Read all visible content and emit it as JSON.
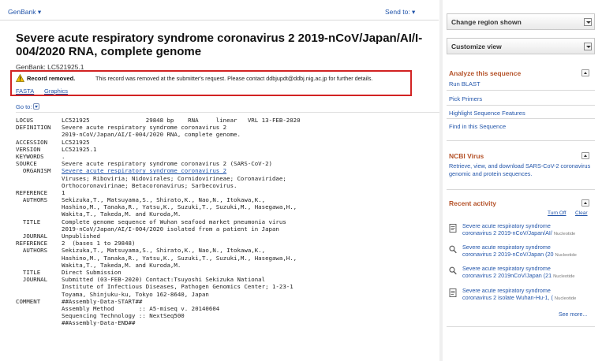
{
  "topbar": {
    "database": "GenBank",
    "send_to": "Send to:"
  },
  "record": {
    "title": "Severe acute respiratory syndrome coronavirus 2 2019-nCoV/Japan/AI/I-004/2020 RNA, complete genome",
    "accession_line": "GenBank: LC521925.1"
  },
  "alert": {
    "title": "Record removed.",
    "message": "This record was removed at the submitter's request. Please contact ddbjupdt@ddbj.nig.ac.jp for further details.",
    "links": [
      "FASTA",
      "Graphics"
    ]
  },
  "goto_label": "Go to:",
  "genbank_lines": [
    {
      "key": "LOCUS",
      "value": "LC521925                29848 bp    RNA     linear   VRL 13-FEB-2020"
    },
    {
      "key": "DEFINITION",
      "value": "Severe acute respiratory syndrome coronavirus 2"
    },
    {
      "key": "",
      "value": "2019-nCoV/Japan/AI/I-004/2020 RNA, complete genome."
    },
    {
      "key": "ACCESSION",
      "value": "LC521925"
    },
    {
      "key": "VERSION",
      "value": "LC521925.1"
    },
    {
      "key": "KEYWORDS",
      "value": "."
    },
    {
      "key": "SOURCE",
      "value": "Severe acute respiratory syndrome coronavirus 2 (SARS-CoV-2)"
    },
    {
      "key": "  ORGANISM",
      "value": "Severe acute respiratory syndrome coronavirus 2",
      "link": true
    },
    {
      "key": "",
      "value": "Viruses; Riboviria; Nidovirales; Cornidovirineae; Coronaviridae;"
    },
    {
      "key": "",
      "value": "Orthocoronavirinae; Betacoronavirus; Sarbecovirus."
    },
    {
      "key": "REFERENCE",
      "value": "1"
    },
    {
      "key": "  AUTHORS",
      "value": "Sekizuka,T., Matsuyama,S., Shirato,K., Nao,N., Itokawa,K.,"
    },
    {
      "key": "",
      "value": "Hashino,M., Tanaka,R., Yatsu,K., Suzuki,T., Suzuki,M., Hasegawa,H.,"
    },
    {
      "key": "",
      "value": "Wakita,T., Takeda,M. and Kuroda,M."
    },
    {
      "key": "  TITLE",
      "value": "Complete genome sequence of Wuhan seafood market pneumonia virus"
    },
    {
      "key": "",
      "value": "2019-nCoV/Japan/AI/I-004/2020 isolated from a patient in Japan"
    },
    {
      "key": "  JOURNAL",
      "value": "Unpublished"
    },
    {
      "key": "REFERENCE",
      "value": "2  (bases 1 to 29848)"
    },
    {
      "key": "  AUTHORS",
      "value": "Sekizuka,T., Matsuyama,S., Shirato,K., Nao,N., Itokawa,K.,"
    },
    {
      "key": "",
      "value": "Hashino,M., Tanaka,R., Yatsu,K., Suzuki,T., Suzuki,M., Hasegawa,H.,"
    },
    {
      "key": "",
      "value": "Wakita,T., Takeda,M. and Kuroda,M."
    },
    {
      "key": "  TITLE",
      "value": "Direct Submission"
    },
    {
      "key": "  JOURNAL",
      "value": "Submitted (03-FEB-2020) Contact:Tsuyoshi Sekizuka National"
    },
    {
      "key": "",
      "value": "Institute of Infectious Diseases, Pathogen Genomics Center; 1-23-1"
    },
    {
      "key": "",
      "value": "Toyama, Shinjuku-ku, Tokyo 162-8640, Japan"
    },
    {
      "key": "COMMENT",
      "value": "##Assembly-Data-START##"
    },
    {
      "key": "",
      "value": "Assembly Method       :: A5-miseq v. 20140604"
    },
    {
      "key": "",
      "value": "Sequencing Technology :: NextSeq500"
    },
    {
      "key": "",
      "value": "##Assembly-Data-END##"
    }
  ],
  "sidebar": {
    "change_region": "Change region shown",
    "customize_view": "Customize view",
    "analyze": {
      "title": "Analyze this sequence",
      "links": [
        "Run BLAST",
        "Pick Primers",
        "Highlight Sequence Features",
        "Find in this Sequence"
      ]
    },
    "ncbi_virus": {
      "title": "NCBI Virus",
      "text": "Retrieve, view, and download SARS-CoV-2 coronavirus genomic and protein sequences."
    },
    "recent": {
      "title": "Recent activity",
      "turn_off": "Turn Off",
      "clear": "Clear",
      "items": [
        {
          "icon": "document-icon",
          "line1": "Severe acute respiratory syndrome",
          "line2": "coronavirus 2 2019-nCoV/Japan/AI/",
          "tag": "Nucleotide"
        },
        {
          "icon": "search-icon",
          "line1": "Severe acute respiratory syndrome",
          "line2": "coronavirus 2 2019-nCoV/Japan (20",
          "tag": "Nucleotide"
        },
        {
          "icon": "search-icon",
          "line1": "Severe acute respiratory syndrome",
          "line2": "coronavirus 2 2019nCoV/Japan (21",
          "tag": "Nucleotide"
        },
        {
          "icon": "document-icon",
          "line1": "Severe acute respiratory syndrome",
          "line2": "coronavirus 2 isolate Wuhan-Hu-1, (",
          "tag": "Nucleotide"
        }
      ],
      "see_more": "See more..."
    }
  },
  "colors": {
    "link": "#2255aa",
    "section_heading": "#b5532a",
    "alert_border": "#d22323"
  }
}
